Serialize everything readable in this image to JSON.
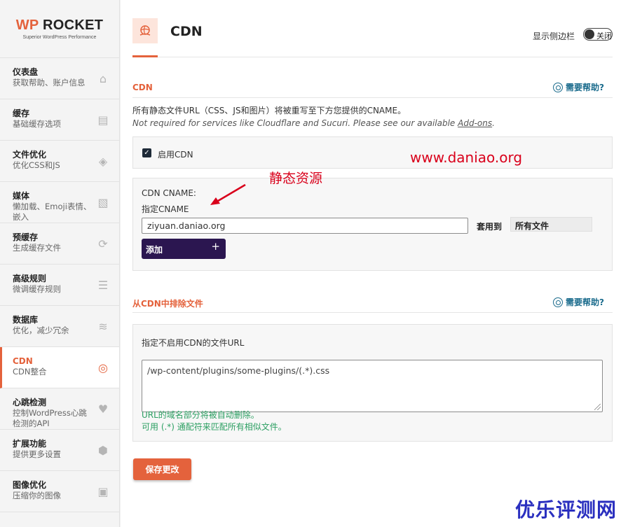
{
  "logo": {
    "brand_prefix": "WP",
    "brand_rest": " ROCKET",
    "tagline": "Superior WordPress Performance"
  },
  "sidebar": {
    "items": [
      {
        "title": "仪表盘",
        "desc": "获取帮助、账户信息",
        "icon": "home-icon"
      },
      {
        "title": "缓存",
        "desc": "基础缓存选项",
        "icon": "document-icon"
      },
      {
        "title": "文件优化",
        "desc": "优化CSS和JS",
        "icon": "layers-icon"
      },
      {
        "title": "媒体",
        "desc": "懒加载、Emoji表情、嵌入",
        "icon": "image-icon"
      },
      {
        "title": "预缓存",
        "desc": "生成缓存文件",
        "icon": "refresh-icon"
      },
      {
        "title": "高级规则",
        "desc": "微调缓存规则",
        "icon": "list-icon"
      },
      {
        "title": "数据库",
        "desc": "优化，减少冗余",
        "icon": "database-icon"
      },
      {
        "title": "CDN",
        "desc": "CDN整合",
        "icon": "cdn-icon",
        "active": true
      },
      {
        "title": "心跳检测",
        "desc": "控制WordPress心跳检测的API",
        "icon": "heartbeat-icon"
      },
      {
        "title": "扩展功能",
        "desc": "提供更多设置",
        "icon": "cubes-icon"
      },
      {
        "title": "图像优化",
        "desc": "压缩你的图像",
        "icon": "image-optimize-icon"
      }
    ]
  },
  "header": {
    "title": "CDN",
    "sidebar_toggle_label": "显示侧边栏",
    "toggle_state": "关闭"
  },
  "cdn_section": {
    "title": "CDN",
    "help": "需要帮助?",
    "desc_line1": "所有静态文件URL（CSS、JS和图片）将被重写至下方您提供的CNAME。",
    "desc_line2_prefix": "Not required for services like Cloudflare and Sucuri. Please see our available ",
    "desc_line2_link": "Add-ons",
    "desc_line2_suffix": ".",
    "enable_label": "启用CDN",
    "cname_label": "CDN CNAME:",
    "cname_sublabel": "指定CNAME",
    "cname_value": "ziyuan.daniao.org",
    "apply_to_label": "套用到",
    "apply_to_value": "所有文件",
    "add_button": "添加",
    "add_plus": "+"
  },
  "exclude_section": {
    "title": "从CDN中排除文件",
    "help": "需要帮助?",
    "field_label": "指定不启用CDN的文件URL",
    "textarea_value": "/wp-content/plugins/some-plugins/(.*).css",
    "helper_line1": "URL的域名部分将被自动删除。",
    "helper_line2": "可用 (.*) 通配符来匹配所有相似文件。"
  },
  "save_button": "保存更改",
  "annotations": {
    "site": "www.daniao.org",
    "static": "静态资源",
    "watermark": "优乐评测网"
  },
  "colors": {
    "accent": "#e4623c",
    "button_dark": "#2b1650",
    "link": "#1a6b8c",
    "success": "#2c9f62",
    "annotation": "#d9001b",
    "watermark": "#2a2fbf"
  }
}
